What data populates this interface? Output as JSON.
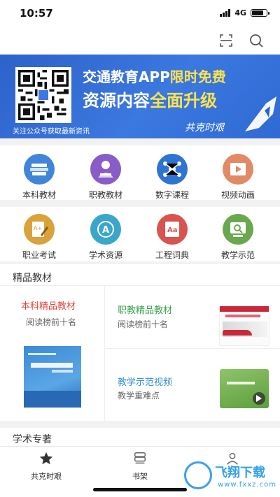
{
  "status_bar": {
    "time": "10:57",
    "network": "4G",
    "battery_level": 0.8
  },
  "top_bar": {
    "icons": [
      "scan-icon",
      "search-icon"
    ]
  },
  "banner": {
    "title_prefix": "交通教育APP",
    "title_highlight": "限时免费",
    "sub_prefix": "资源内容",
    "sub_highlight": "全面升级",
    "follow_text": "关注公众号获取最新资讯",
    "signature": "共克时艰"
  },
  "grid_row1": [
    {
      "label": "本科教材",
      "icon": "books-icon",
      "color": "#3f86d8"
    },
    {
      "label": "职教教材",
      "icon": "teacher-icon",
      "color": "#8a5cc7"
    },
    {
      "label": "数字课程",
      "icon": "network-icon",
      "color": "#2f74d0"
    },
    {
      "label": "视频动画",
      "icon": "video-icon",
      "color": "#e08a66"
    }
  ],
  "grid_row2": [
    {
      "label": "职业考试",
      "icon": "exam-icon",
      "color": "#d9a23a"
    },
    {
      "label": "学术资源",
      "icon": "academic-icon",
      "color": "#3aa6c9"
    },
    {
      "label": "工程词典",
      "icon": "dictionary-icon",
      "color": "#d9534f"
    },
    {
      "label": "教学示范",
      "icon": "demo-icon",
      "color": "#6aa84f"
    }
  ],
  "sections": {
    "featured_title": "精品教材",
    "featured_left": {
      "title": "本科精品教材",
      "subtitle": "阅读榜前十名",
      "title_color": "#e0483c"
    },
    "featured_right_top": {
      "title": "职教精品教材",
      "subtitle": "阅读榜前十名",
      "title_color": "#3aa34f"
    },
    "featured_right_bottom": {
      "title": "教学示范视频",
      "subtitle": "教学重难点",
      "title_color": "#3a8fd0"
    },
    "academic_title": "学术专著"
  },
  "tabbar": [
    {
      "label": "共克时艰",
      "icon": "star-icon"
    },
    {
      "label": "书架",
      "icon": "bookshelf-icon"
    },
    {
      "label": "",
      "icon": "profile-icon"
    }
  ],
  "watermark": {
    "text": "飞翔下载",
    "url": "www.fxxz.com"
  }
}
